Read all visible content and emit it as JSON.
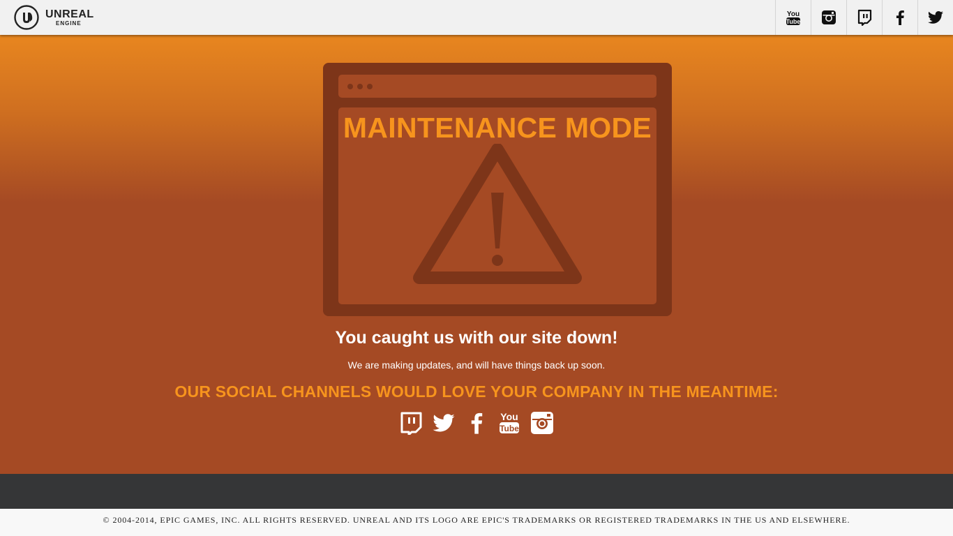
{
  "brand": {
    "name": "UNREAL",
    "subname": "ENGINE",
    "logo_icon": "unreal-logo-icon"
  },
  "header": {
    "social_icons": [
      "youtube-icon",
      "instagram-icon",
      "twitch-icon",
      "facebook-icon",
      "twitter-icon"
    ]
  },
  "main": {
    "maintenance_title": "MAINTENANCE MODE",
    "headline": "You caught us with our site down!",
    "subline": "We are making updates, and will have things back up soon.",
    "social_heading": "OUR SOCIAL CHANNELS WOULD LOVE YOUR COMPANY IN THE MEANTIME:",
    "social_icons": [
      "twitch-icon",
      "twitter-icon",
      "facebook-icon",
      "youtube-icon",
      "instagram-icon"
    ]
  },
  "footer": {
    "copyright": "© 2004-2014, EPIC GAMES, INC. ALL RIGHTS RESERVED. UNREAL AND ITS LOGO ARE EPIC'S TRADEMARKS OR REGISTERED TRADEMARKS IN THE US AND ELSEWHERE."
  },
  "colors": {
    "header_bg": "#f1f1f1",
    "hero_top": "#e8861f",
    "hero_bottom": "#a54a24",
    "art_dark": "#7d3519",
    "accent_orange": "#f7941d",
    "footer_band": "#353637",
    "footer_legal_bg": "#f8f8f8"
  }
}
